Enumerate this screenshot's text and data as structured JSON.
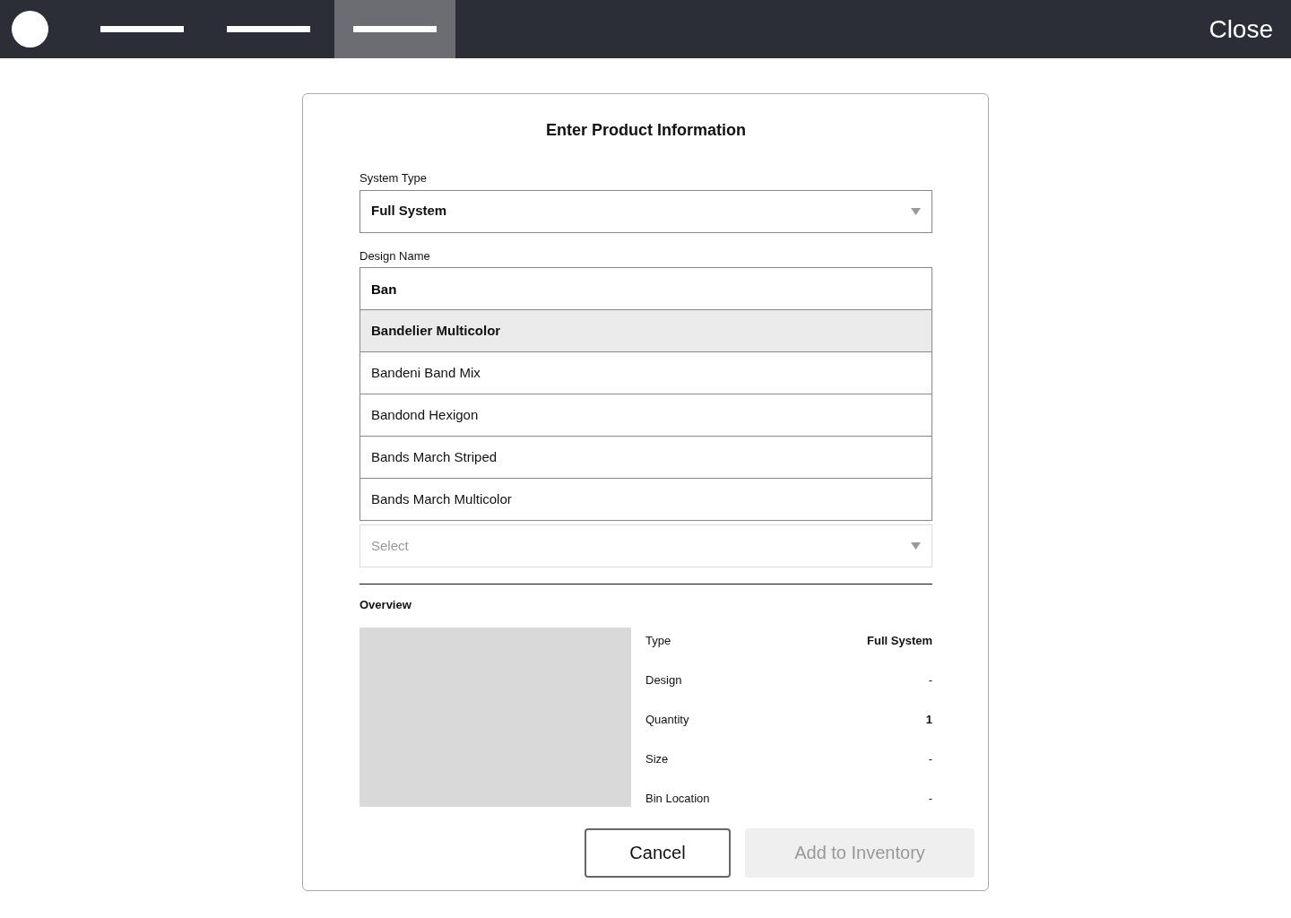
{
  "nav": {
    "tabs": [
      {
        "selected": false
      },
      {
        "selected": false
      },
      {
        "selected": true
      }
    ],
    "close": "Close"
  },
  "form": {
    "title": "Enter Product Information",
    "system_type": {
      "label": "System Type",
      "value": "Full System"
    },
    "design_name": {
      "label": "Design Name",
      "value": "Ban",
      "suggestions": [
        {
          "text": "Bandelier Multicolor",
          "selected": true
        },
        {
          "text": "Bandeni Band Mix",
          "selected": false
        },
        {
          "text": "Bandond Hexigon",
          "selected": false
        },
        {
          "text": "Bands March Striped",
          "selected": false
        },
        {
          "text": "Bands March Multicolor",
          "selected": false
        }
      ]
    },
    "next_select": {
      "placeholder": "Select",
      "disabled": true
    }
  },
  "overview": {
    "heading": "Overview",
    "rows": [
      {
        "label": "Type",
        "value": "Full System",
        "bold": true
      },
      {
        "label": "Design",
        "value": "-",
        "bold": false
      },
      {
        "label": "Quantity",
        "value": "1",
        "bold": true
      },
      {
        "label": "Size",
        "value": "-",
        "bold": false
      },
      {
        "label": "Bin Location",
        "value": "-",
        "bold": false
      }
    ]
  },
  "buttons": [
    {
      "label": "Cancel",
      "kind": "secondary",
      "disabled": false
    },
    {
      "label": "Add to Inventory",
      "kind": "primary",
      "disabled": true
    }
  ]
}
